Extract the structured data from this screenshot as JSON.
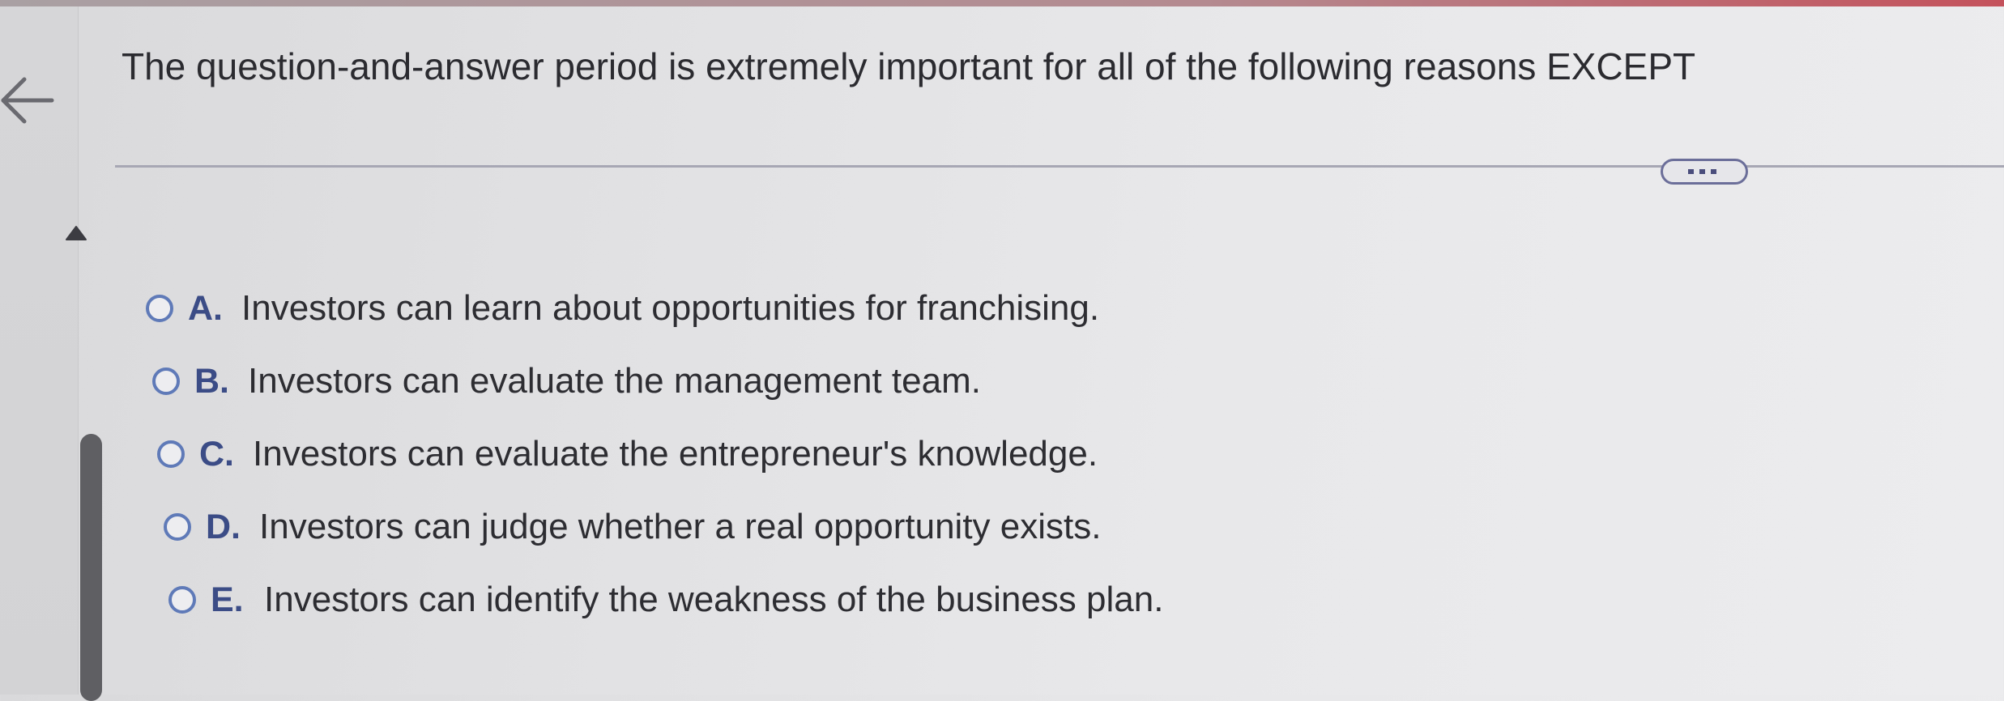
{
  "question": {
    "text": "The question-and-answer period is extremely important for all of the following reasons EXCEPT"
  },
  "toolbar": {
    "back_icon": "arrow-left-icon",
    "collapse_icon": "caret-up-icon",
    "more_icon": "ellipsis-icon"
  },
  "options": [
    {
      "letter": "A.",
      "text": "Investors can learn about opportunities for franchising."
    },
    {
      "letter": "B.",
      "text": "Investors can evaluate the management team."
    },
    {
      "letter": "C.",
      "text": "Investors can evaluate the entrepreneur's knowledge."
    },
    {
      "letter": "D.",
      "text": "Investors can judge whether a real opportunity exists."
    },
    {
      "letter": "E.",
      "text": "Investors can identify the weakness of the business plan."
    }
  ],
  "colors": {
    "accent": "#5f7ab8",
    "letter": "#3b4c86",
    "text": "#2b2b30",
    "top_strip": "#c4525c"
  }
}
